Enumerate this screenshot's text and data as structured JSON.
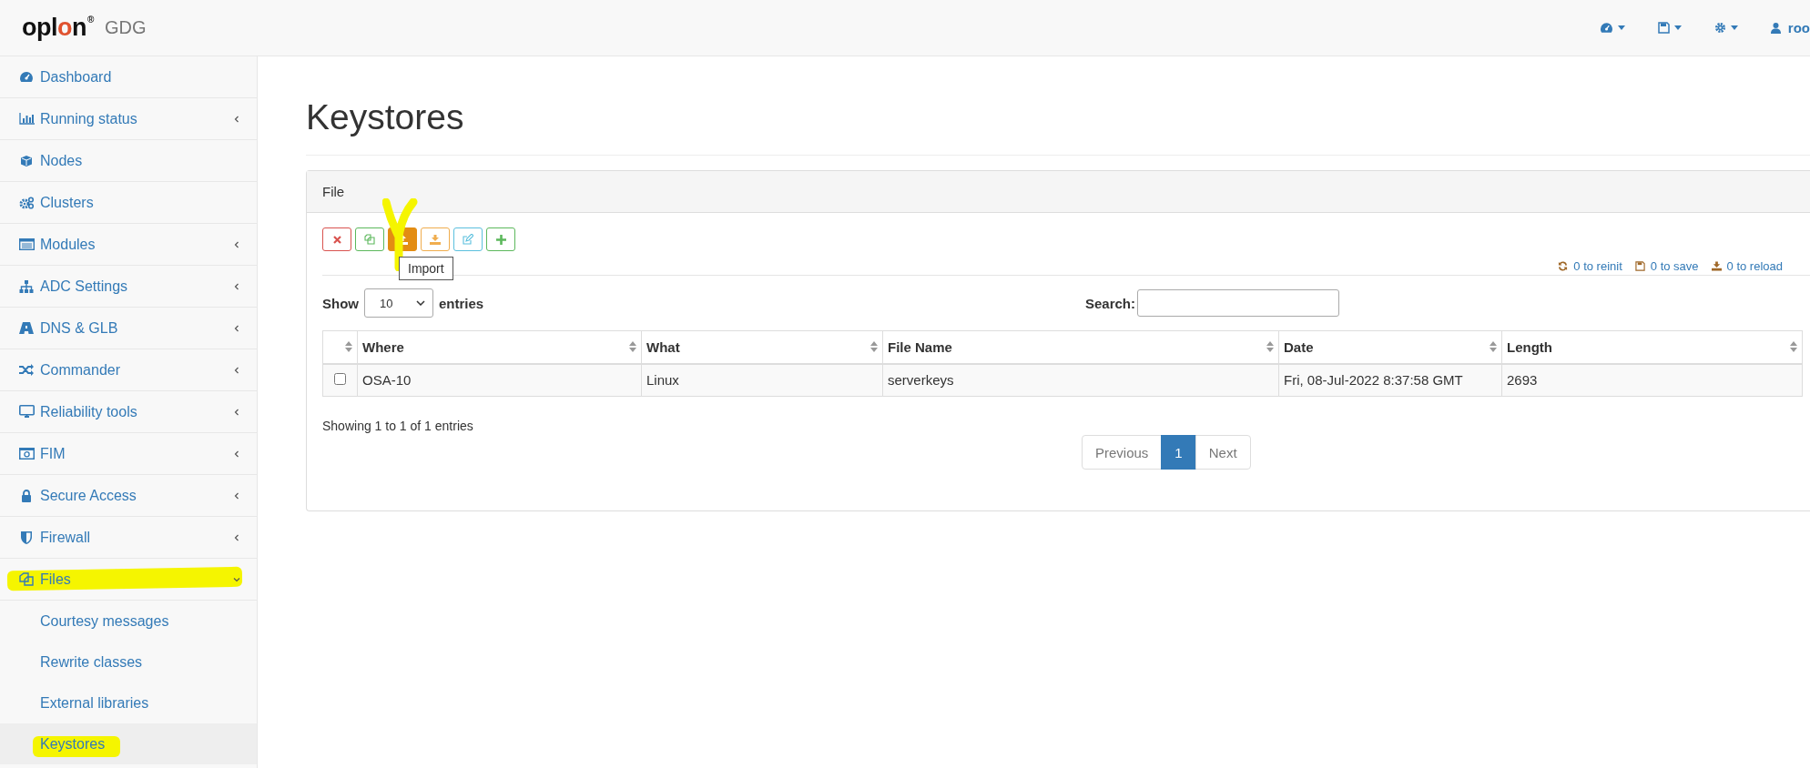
{
  "header": {
    "logo": [
      {
        "text": "opl",
        "accent": false
      },
      {
        "text": "o",
        "accent": true
      },
      {
        "text": "n",
        "accent": false
      }
    ],
    "logo_mark": "®",
    "product": "GDG",
    "user": "roo"
  },
  "sidebar": {
    "items": [
      {
        "label": "Dashboard",
        "kind": "link",
        "highlighted": false
      },
      {
        "label": "Running status",
        "kind": "menu",
        "expanded": false,
        "highlighted": false
      },
      {
        "label": "Nodes",
        "kind": "link",
        "highlighted": false
      },
      {
        "label": "Clusters",
        "kind": "link",
        "highlighted": false
      },
      {
        "label": "Modules",
        "kind": "menu",
        "expanded": false,
        "highlighted": false
      },
      {
        "label": "ADC Settings",
        "kind": "menu",
        "expanded": false,
        "highlighted": false
      },
      {
        "label": "DNS & GLB",
        "kind": "menu",
        "expanded": false,
        "highlighted": false
      },
      {
        "label": "Commander",
        "kind": "menu",
        "expanded": false,
        "highlighted": false
      },
      {
        "label": "Reliability tools",
        "kind": "menu",
        "expanded": false,
        "highlighted": false
      },
      {
        "label": "FIM",
        "kind": "menu",
        "expanded": false,
        "highlighted": false
      },
      {
        "label": "Secure Access",
        "kind": "menu",
        "expanded": false,
        "highlighted": false
      },
      {
        "label": "Firewall",
        "kind": "menu",
        "expanded": false,
        "highlighted": false
      },
      {
        "label": "Files",
        "kind": "menu",
        "expanded": true,
        "highlighted": true,
        "children": [
          {
            "label": "Courtesy messages",
            "selected": false,
            "highlighted": false
          },
          {
            "label": "Rewrite classes",
            "selected": false,
            "highlighted": false
          },
          {
            "label": "External libraries",
            "selected": false,
            "highlighted": false
          },
          {
            "label": "Keystores",
            "selected": true,
            "highlighted": true
          }
        ]
      }
    ]
  },
  "page": {
    "title": "Keystores"
  },
  "panel": {
    "heading": "File",
    "toolbar": [
      {
        "kind": "delete",
        "active": false,
        "marked": false
      },
      {
        "kind": "copy",
        "active": false,
        "marked": false
      },
      {
        "kind": "import",
        "active": true,
        "marked": true
      },
      {
        "kind": "export",
        "active": false,
        "marked": false
      },
      {
        "kind": "edit",
        "active": false,
        "marked": false
      },
      {
        "kind": "add",
        "active": false,
        "marked": false
      }
    ],
    "tooltip": "Import",
    "status": [
      {
        "kind": "reinit",
        "label": "0 to reinit"
      },
      {
        "kind": "save",
        "label": "0 to save"
      },
      {
        "kind": "reload",
        "label": "0 to reload"
      }
    ],
    "length": {
      "before": "Show",
      "value": "10",
      "after": "entries"
    },
    "search": {
      "label": "Search:"
    },
    "table": {
      "columns": [
        "Where",
        "What",
        "File Name",
        "Date",
        "Length"
      ],
      "rows": [
        {
          "checked": false,
          "cells": [
            "OSA-10",
            "Linux",
            "serverkeys",
            "Fri, 08-Jul-2022 8:37:58 GMT",
            "2693"
          ]
        }
      ]
    },
    "info": "Showing 1 to 1 of 1 entries",
    "pagination": [
      {
        "label": "Previous",
        "selected": false
      },
      {
        "label": "1",
        "selected": true
      },
      {
        "label": "Next",
        "selected": false
      }
    ]
  }
}
